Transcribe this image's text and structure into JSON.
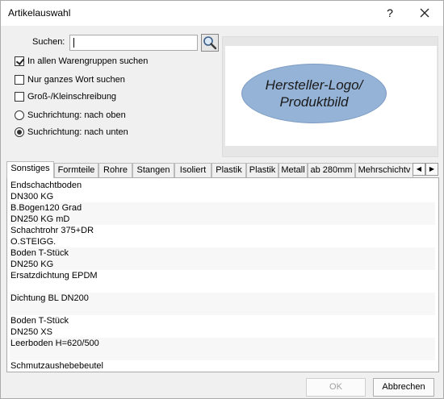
{
  "window": {
    "title": "Artikelauswahl"
  },
  "search": {
    "label": "Suchen:",
    "value": ""
  },
  "options": {
    "all_groups": {
      "label": "In allen Warengruppen suchen",
      "checked": true
    },
    "whole_word": {
      "label": "Nur ganzes Wort suchen",
      "checked": false
    },
    "case_sensitive": {
      "label": "Groß-/Kleinschreibung",
      "checked": false
    },
    "dir_up": {
      "label": "Suchrichtung: nach oben",
      "checked": false
    },
    "dir_down": {
      "label": "Suchrichtung: nach unten",
      "checked": true
    }
  },
  "logo": {
    "line1": "Hersteller-Logo/",
    "line2": "Produktbild"
  },
  "tabs": [
    "Sonstiges",
    "Formteile",
    "Rohre",
    "Stangen",
    "Isoliert",
    "Plastik",
    "Plastik",
    "Metall",
    "ab 280mm",
    "Mehrschichtv"
  ],
  "items": [
    [
      "Endschachtboden",
      "DN300 KG"
    ],
    [
      "B.Bogen120 Grad",
      "DN250 KG mD"
    ],
    [
      "Schachtrohr 375+DR",
      "O.STEIGG."
    ],
    [
      "Boden T-Stück",
      "DN250 KG"
    ],
    [
      "Ersatzdichtung EPDM",
      ""
    ],
    [
      "Dichtung BL DN200",
      ""
    ],
    [
      "Boden T-Stück",
      "DN250 XS"
    ],
    [
      "Leerboden H=620/500",
      ""
    ],
    [
      "Schmutzaushebebeutel",
      ""
    ]
  ],
  "buttons": {
    "ok": "OK",
    "cancel": "Abbrechen"
  },
  "colors": {
    "logo_fill": "#95b3d7"
  }
}
